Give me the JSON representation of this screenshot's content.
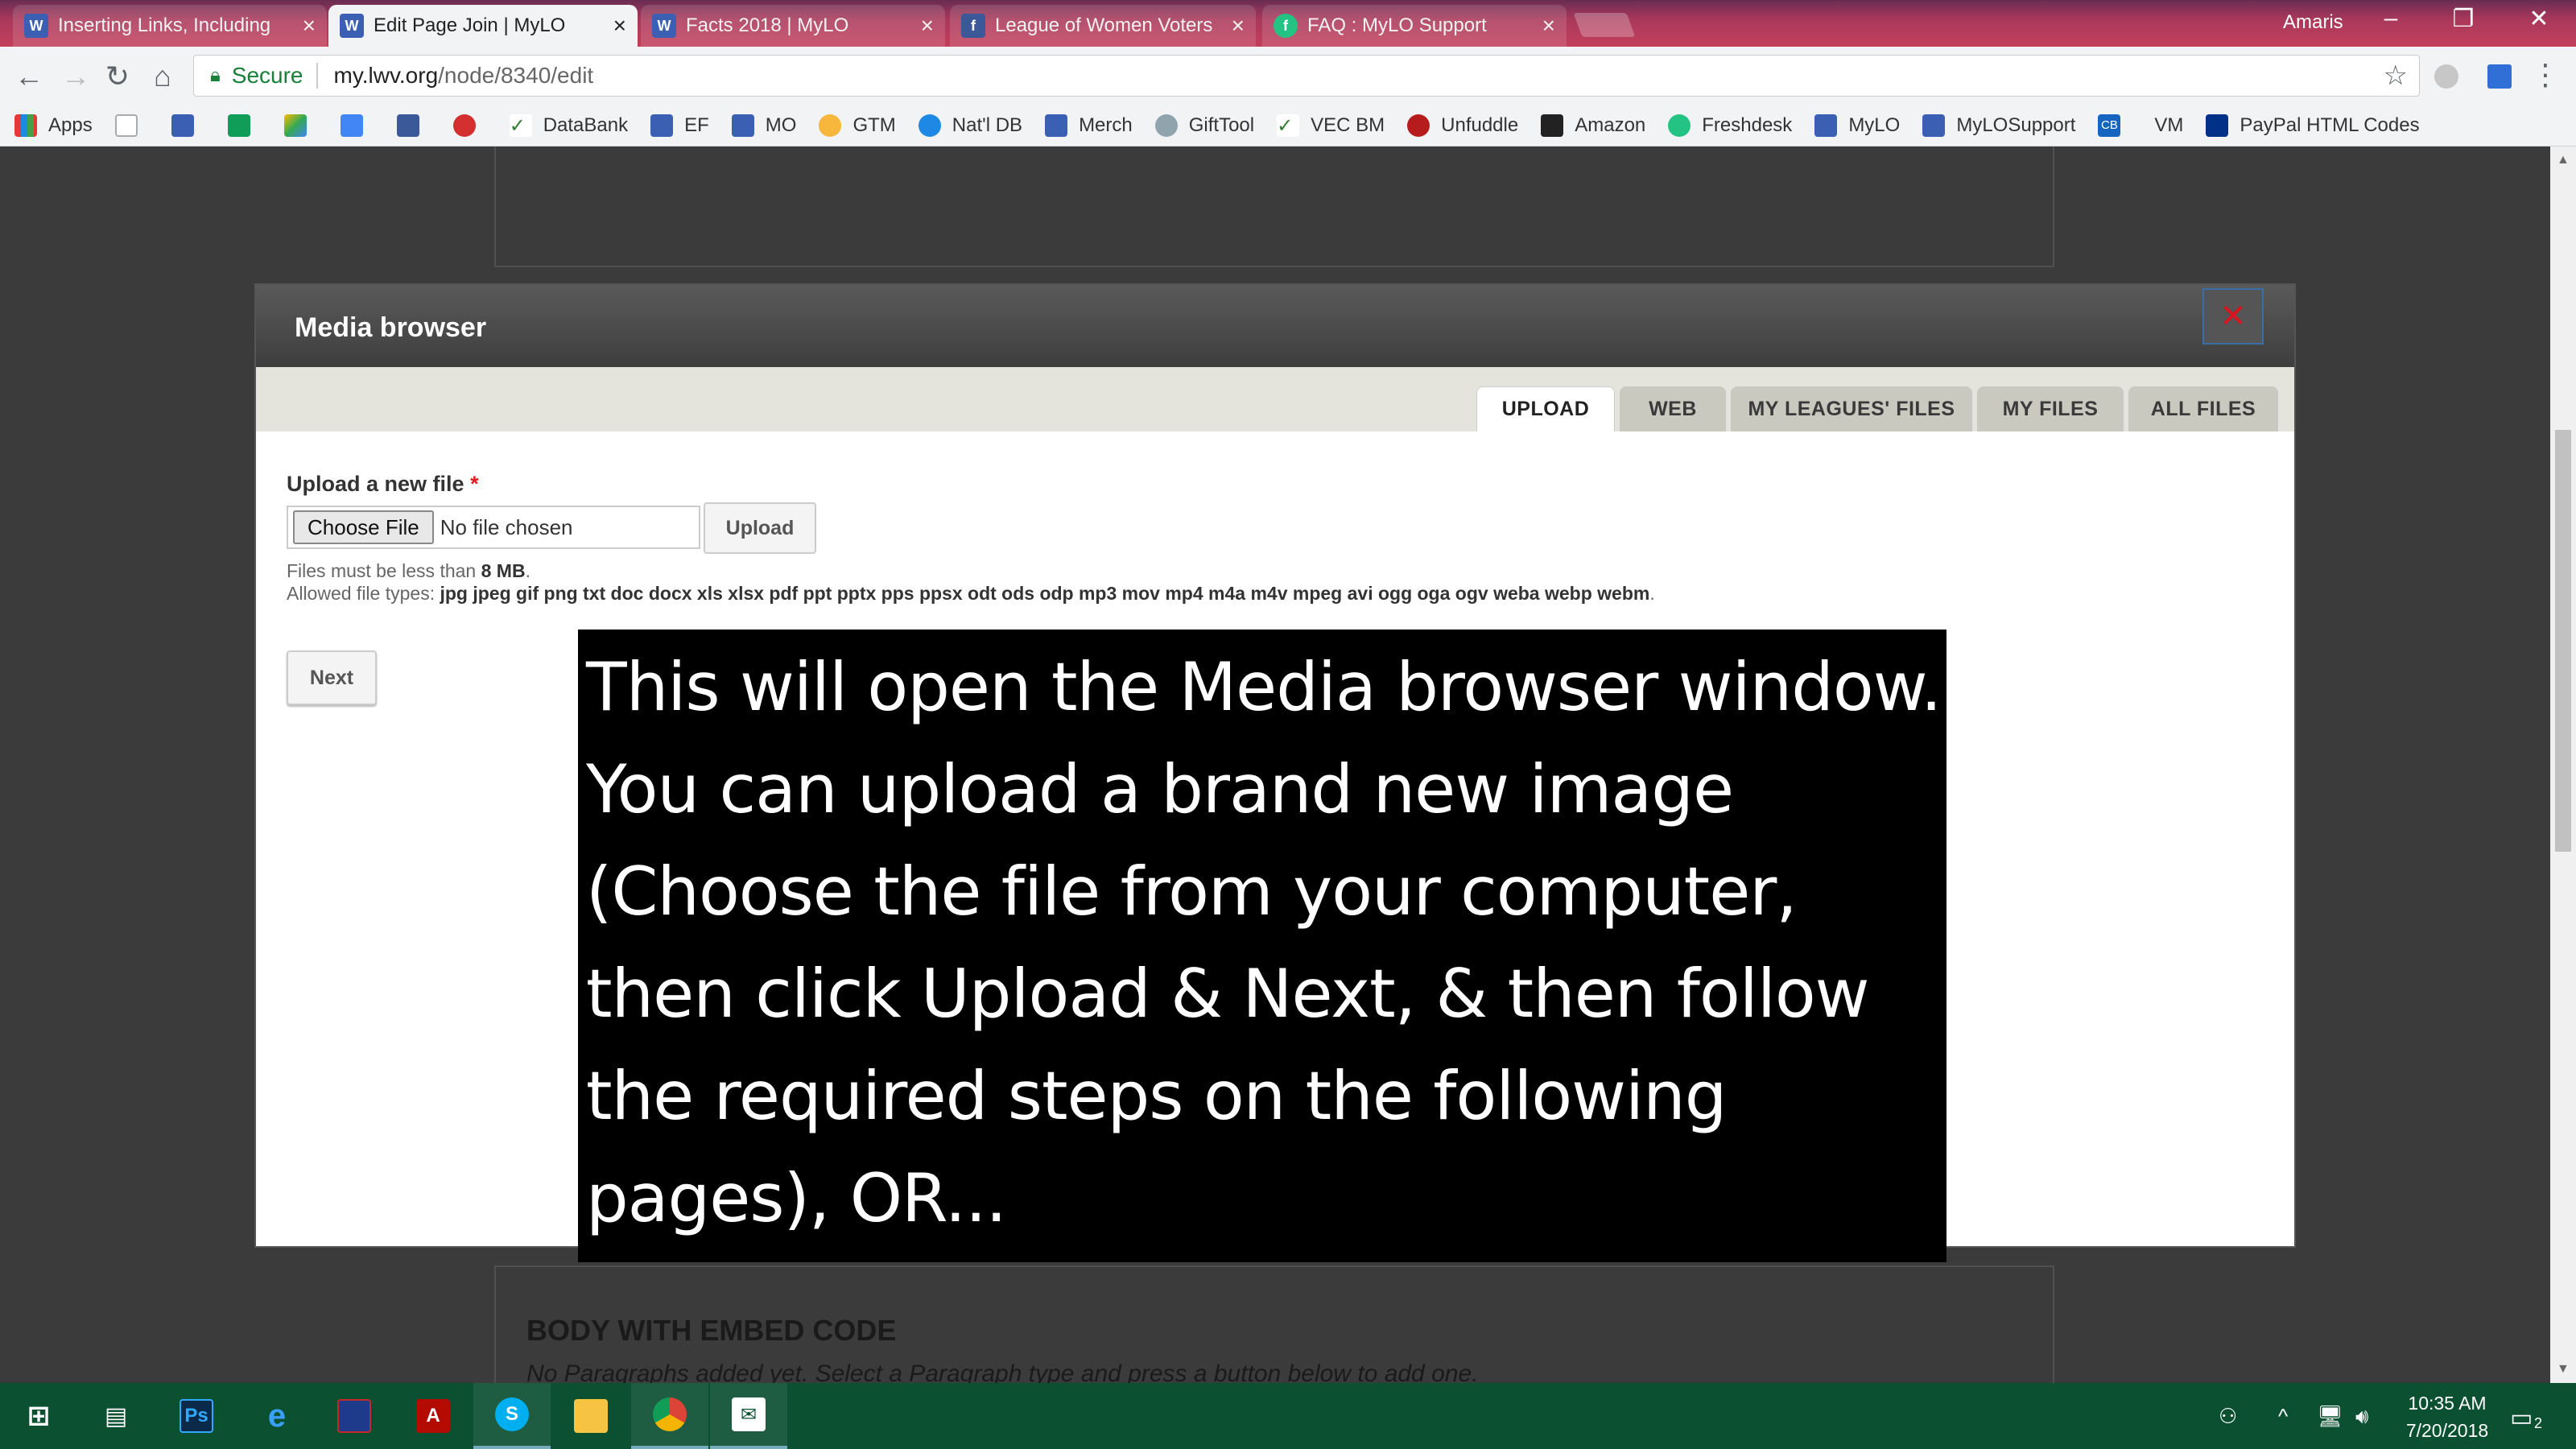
{
  "browser": {
    "tabs": [
      {
        "title": "Inserting Links, Including",
        "active": false,
        "favicon": "lwv-icon"
      },
      {
        "title": "Edit Page Join | MyLO",
        "active": true,
        "favicon": "lwv-icon"
      },
      {
        "title": "Facts 2018 | MyLO",
        "active": false,
        "favicon": "lwv-icon"
      },
      {
        "title": "League of Women Voters",
        "active": false,
        "favicon": "facebook-icon"
      },
      {
        "title": "FAQ : MyLO Support",
        "active": false,
        "favicon": "freshdesk-icon"
      }
    ],
    "user": "Amaris",
    "address": {
      "secure_label": "Secure",
      "domain": "my.lwv.org",
      "path": "/node/8340/edit"
    },
    "bookmarks": [
      "Apps",
      "DataBank",
      "EF",
      "MO",
      "GTM",
      "Nat'l DB",
      "Merch",
      "GiftTool",
      "VEC BM",
      "Unfuddle",
      "Amazon",
      "Freshdesk",
      "MyLO",
      "MyLOSupport",
      "VM",
      "PayPal HTML Codes"
    ],
    "bookmark_icons": {
      "CB": "CB"
    }
  },
  "modal": {
    "title": "Media browser",
    "close_label": "✕",
    "tabs": [
      "UPLOAD",
      "WEB",
      "MY LEAGUES' FILES",
      "MY FILES",
      "ALL FILES"
    ],
    "active_tab": "UPLOAD",
    "upload": {
      "label": "Upload a new file",
      "required_mark": "*",
      "choose_label": "Choose File",
      "no_file_text": "No file chosen",
      "upload_label": "Upload",
      "size_help_prefix": "Files must be less than ",
      "size_help_value": "8 MB",
      "size_help_suffix": ".",
      "types_help_prefix": "Allowed file types: ",
      "types_help_value": "jpg jpeg gif png txt doc docx xls xlsx pdf ppt pptx pps ppsx odt ods odp mp3 mov mp4 m4a m4v mpeg avi ogg oga ogv weba webp webm",
      "types_help_suffix": ".",
      "next_label": "Next"
    }
  },
  "caption": "This will open the Media browser window. You can upload a brand new image (Choose the file from your computer, then click Upload & Next, & then follow the required steps on the following pages), OR...",
  "page_behind": {
    "section_heading": "BODY WITH EMBED CODE",
    "section_note": "No Paragraphs added yet. Select a Paragraph type and press a button below to add one."
  },
  "taskbar": {
    "time": "10:35 AM",
    "date": "7/20/2018",
    "notification_count": "2",
    "ps_label": "Ps"
  },
  "colors": {
    "titlebar": "#a8385b",
    "modal_header": "#4a4a4a",
    "taskbar": "#0c5032",
    "required": "#e01b1b",
    "close_x": "#d8141c"
  }
}
